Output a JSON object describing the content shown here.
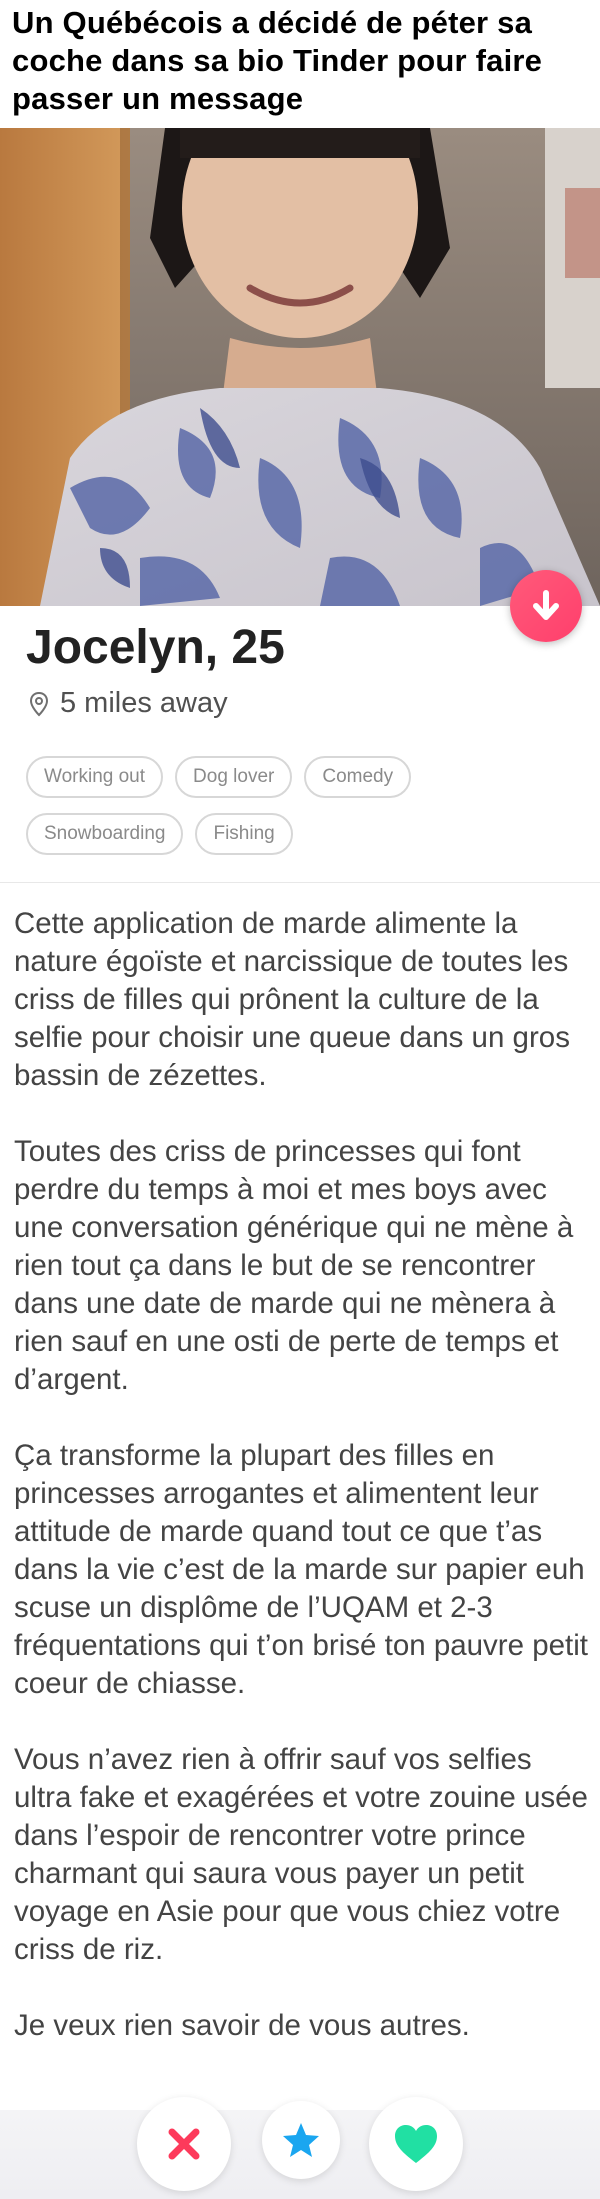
{
  "headline": "Un Québécois a décidé de péter sa coche dans sa bio Tinder pour faire passer un message",
  "profile": {
    "name_age": "Jocelyn, 25",
    "distance": "5 miles away"
  },
  "interests": [
    "Working out",
    "Dog lover",
    "Comedy",
    "Snowboarding",
    "Fishing"
  ],
  "bio": [
    "Cette application de marde alimente la nature égoïste et narcissique de toutes les criss de filles qui prônent la culture de la selfie pour choisir une queue dans un gros bassin de zézettes.",
    "Toutes des criss de princesses qui font perdre du temps à moi et mes boys avec une conversation générique qui ne mène à rien tout ça dans le but de se rencontrer dans une date de marde qui ne mènera à rien sauf en une osti de perte de temps et d’argent.",
    "Ça transforme la plupart des filles en princesses arrogantes et alimentent leur attitude de marde quand tout ce que t’as dans la vie c’est de la marde sur papier euh scuse un displôme de l’UQAM et 2-3 fréquentations qui t’on brisé ton pauvre petit coeur de chiasse.",
    "Vous n’avez rien à offrir sauf vos selfies ultra fake et exagérées et votre zouine usée dans l’espoir de rencontrer votre prince charmant qui saura vous payer un petit voyage en Asie pour que vous chiez votre criss de riz.",
    "Je veux rien savoir de vous autres."
  ],
  "colors": {
    "fab_pink": "#ff4d72",
    "nope_red": "#fd3a5b",
    "super_blue": "#1aa6f0",
    "like_green": "#21e0a3"
  },
  "icons": {
    "fab": "arrow-down-icon",
    "distance": "location-pin-icon",
    "nope": "x-icon",
    "super_like": "star-icon",
    "like": "heart-icon"
  }
}
